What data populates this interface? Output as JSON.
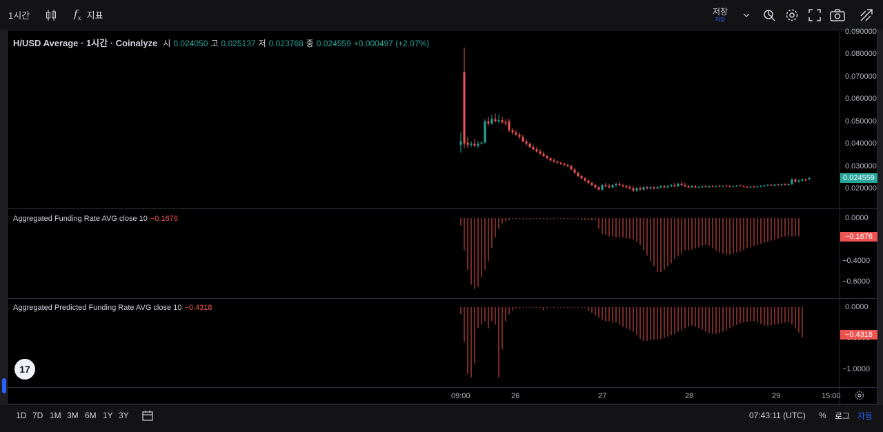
{
  "toolbar": {
    "interval": "1시간",
    "indicators_label": "지표",
    "save_label": "저장",
    "save_sub": "저장",
    "icons": [
      "candles-icon",
      "fx-icon",
      "chevron-down-icon",
      "replay-icon",
      "gear-icon",
      "fullscreen-icon",
      "camera-icon",
      "publish-icon"
    ]
  },
  "legend": {
    "title": "H/USD Average · 1시간 · Coinalyze",
    "open_label": "시",
    "open": "0.024050",
    "high_label": "고",
    "high": "0.025137",
    "low_label": "저",
    "low": "0.023768",
    "close_label": "종",
    "close": "0.024559",
    "change": "+0.000497 (+2.07%)"
  },
  "price_axis": {
    "ticks": [
      "0.090000",
      "0.080000",
      "0.070000",
      "0.060000",
      "0.050000",
      "0.040000",
      "0.030000",
      "0.020000"
    ],
    "last": "0.024559"
  },
  "funding": {
    "name": "Aggregated Funding Rate AVG close 10",
    "value": "−0.1676",
    "ticks": [
      "0.0000",
      "−0.2000",
      "−0.4000",
      "−0.6000"
    ],
    "tag": "−0.1676"
  },
  "predicted": {
    "name": "Aggregated Predicted Funding Rate AVG close 10",
    "value": "−0.4318",
    "ticks": [
      "0.0000",
      "−0.5000",
      "−1.0000"
    ],
    "tag": "−0.4318"
  },
  "time_axis": [
    "09:00",
    "26",
    "27",
    "28",
    "29",
    "15:00"
  ],
  "bottombar": {
    "ranges": [
      "1D",
      "7D",
      "1M",
      "3M",
      "6M",
      "1Y",
      "3Y"
    ],
    "clock": "07:43:11 (UTC)",
    "percent": "%",
    "log": "로그",
    "auto": "자동"
  },
  "colors": {
    "up": "#26a69a",
    "down": "#ef5350",
    "accent": "#2962ff"
  },
  "chart_data": {
    "type": "candlestick",
    "price_min": 0.015,
    "price_max": 0.09,
    "candles": [
      {
        "o": 0.0395,
        "h": 0.045,
        "l": 0.036,
        "c": 0.041
      },
      {
        "o": 0.072,
        "h": 0.083,
        "l": 0.038,
        "c": 0.04
      },
      {
        "o": 0.0405,
        "h": 0.043,
        "l": 0.038,
        "c": 0.0395
      },
      {
        "o": 0.0395,
        "h": 0.041,
        "l": 0.0385,
        "c": 0.04
      },
      {
        "o": 0.04,
        "h": 0.042,
        "l": 0.0385,
        "c": 0.039
      },
      {
        "o": 0.039,
        "h": 0.041,
        "l": 0.038,
        "c": 0.04
      },
      {
        "o": 0.04,
        "h": 0.041,
        "l": 0.0395,
        "c": 0.0405
      },
      {
        "o": 0.0405,
        "h": 0.051,
        "l": 0.04,
        "c": 0.05
      },
      {
        "o": 0.05,
        "h": 0.052,
        "l": 0.048,
        "c": 0.049
      },
      {
        "o": 0.049,
        "h": 0.053,
        "l": 0.0485,
        "c": 0.051
      },
      {
        "o": 0.051,
        "h": 0.0535,
        "l": 0.0495,
        "c": 0.05
      },
      {
        "o": 0.05,
        "h": 0.053,
        "l": 0.049,
        "c": 0.0505
      },
      {
        "o": 0.0505,
        "h": 0.052,
        "l": 0.049,
        "c": 0.0495
      },
      {
        "o": 0.0495,
        "h": 0.051,
        "l": 0.048,
        "c": 0.049
      },
      {
        "o": 0.05,
        "h": 0.051,
        "l": 0.045,
        "c": 0.046
      },
      {
        "o": 0.046,
        "h": 0.047,
        "l": 0.044,
        "c": 0.045
      },
      {
        "o": 0.045,
        "h": 0.046,
        "l": 0.0435,
        "c": 0.044
      },
      {
        "o": 0.044,
        "h": 0.045,
        "l": 0.042,
        "c": 0.043
      },
      {
        "o": 0.043,
        "h": 0.044,
        "l": 0.0405,
        "c": 0.041
      },
      {
        "o": 0.041,
        "h": 0.042,
        "l": 0.039,
        "c": 0.04
      },
      {
        "o": 0.04,
        "h": 0.0405,
        "l": 0.038,
        "c": 0.0385
      },
      {
        "o": 0.0385,
        "h": 0.0395,
        "l": 0.037,
        "c": 0.0375
      },
      {
        "o": 0.0375,
        "h": 0.0385,
        "l": 0.036,
        "c": 0.0365
      },
      {
        "o": 0.0365,
        "h": 0.0375,
        "l": 0.035,
        "c": 0.0355
      },
      {
        "o": 0.0355,
        "h": 0.0365,
        "l": 0.034,
        "c": 0.0345
      },
      {
        "o": 0.0345,
        "h": 0.035,
        "l": 0.033,
        "c": 0.0335
      },
      {
        "o": 0.0335,
        "h": 0.034,
        "l": 0.032,
        "c": 0.0325
      },
      {
        "o": 0.0325,
        "h": 0.0335,
        "l": 0.0315,
        "c": 0.032
      },
      {
        "o": 0.032,
        "h": 0.0325,
        "l": 0.031,
        "c": 0.0315
      },
      {
        "o": 0.0315,
        "h": 0.032,
        "l": 0.0305,
        "c": 0.031
      },
      {
        "o": 0.031,
        "h": 0.0315,
        "l": 0.03,
        "c": 0.0305
      },
      {
        "o": 0.0305,
        "h": 0.031,
        "l": 0.0295,
        "c": 0.03
      },
      {
        "o": 0.03,
        "h": 0.0305,
        "l": 0.028,
        "c": 0.0285
      },
      {
        "o": 0.0285,
        "h": 0.029,
        "l": 0.0265,
        "c": 0.027
      },
      {
        "o": 0.027,
        "h": 0.0275,
        "l": 0.025,
        "c": 0.0255
      },
      {
        "o": 0.0255,
        "h": 0.026,
        "l": 0.024,
        "c": 0.0245
      },
      {
        "o": 0.0245,
        "h": 0.025,
        "l": 0.023,
        "c": 0.0235
      },
      {
        "o": 0.0235,
        "h": 0.024,
        "l": 0.022,
        "c": 0.0225
      },
      {
        "o": 0.0225,
        "h": 0.023,
        "l": 0.021,
        "c": 0.0215
      },
      {
        "o": 0.0215,
        "h": 0.022,
        "l": 0.02,
        "c": 0.0205
      },
      {
        "o": 0.0205,
        "h": 0.021,
        "l": 0.019,
        "c": 0.0195
      },
      {
        "o": 0.0195,
        "h": 0.022,
        "l": 0.019,
        "c": 0.0215
      },
      {
        "o": 0.0215,
        "h": 0.0225,
        "l": 0.0205,
        "c": 0.021
      },
      {
        "o": 0.021,
        "h": 0.022,
        "l": 0.02,
        "c": 0.0205
      },
      {
        "o": 0.0205,
        "h": 0.022,
        "l": 0.02,
        "c": 0.0215
      },
      {
        "o": 0.0215,
        "h": 0.0225,
        "l": 0.0205,
        "c": 0.022
      },
      {
        "o": 0.022,
        "h": 0.023,
        "l": 0.021,
        "c": 0.0215
      },
      {
        "o": 0.0215,
        "h": 0.022,
        "l": 0.0205,
        "c": 0.021
      },
      {
        "o": 0.021,
        "h": 0.0215,
        "l": 0.02,
        "c": 0.0205
      },
      {
        "o": 0.0205,
        "h": 0.0215,
        "l": 0.0195,
        "c": 0.02
      },
      {
        "o": 0.02,
        "h": 0.021,
        "l": 0.0185,
        "c": 0.019
      },
      {
        "o": 0.019,
        "h": 0.0205,
        "l": 0.0185,
        "c": 0.02
      },
      {
        "o": 0.02,
        "h": 0.021,
        "l": 0.019,
        "c": 0.0195
      },
      {
        "o": 0.0195,
        "h": 0.021,
        "l": 0.019,
        "c": 0.0205
      },
      {
        "o": 0.0205,
        "h": 0.021,
        "l": 0.0195,
        "c": 0.02
      },
      {
        "o": 0.02,
        "h": 0.021,
        "l": 0.0195,
        "c": 0.0205
      },
      {
        "o": 0.0205,
        "h": 0.021,
        "l": 0.0195,
        "c": 0.02
      },
      {
        "o": 0.02,
        "h": 0.021,
        "l": 0.0195,
        "c": 0.0205
      },
      {
        "o": 0.0205,
        "h": 0.0215,
        "l": 0.02,
        "c": 0.021
      },
      {
        "o": 0.021,
        "h": 0.0215,
        "l": 0.02,
        "c": 0.0205
      },
      {
        "o": 0.0205,
        "h": 0.0215,
        "l": 0.02,
        "c": 0.021
      },
      {
        "o": 0.021,
        "h": 0.022,
        "l": 0.0205,
        "c": 0.0215
      },
      {
        "o": 0.0215,
        "h": 0.0225,
        "l": 0.0205,
        "c": 0.021
      },
      {
        "o": 0.021,
        "h": 0.0225,
        "l": 0.0205,
        "c": 0.022
      },
      {
        "o": 0.022,
        "h": 0.023,
        "l": 0.021,
        "c": 0.0215
      },
      {
        "o": 0.0215,
        "h": 0.0225,
        "l": 0.0205,
        "c": 0.021
      },
      {
        "o": 0.021,
        "h": 0.0215,
        "l": 0.02,
        "c": 0.0205
      },
      {
        "o": 0.0205,
        "h": 0.0215,
        "l": 0.02,
        "c": 0.021
      },
      {
        "o": 0.021,
        "h": 0.0215,
        "l": 0.02,
        "c": 0.0205
      },
      {
        "o": 0.0205,
        "h": 0.021,
        "l": 0.02,
        "c": 0.0207
      },
      {
        "o": 0.0207,
        "h": 0.0212,
        "l": 0.0202,
        "c": 0.0209
      },
      {
        "o": 0.0209,
        "h": 0.0214,
        "l": 0.0204,
        "c": 0.0206
      },
      {
        "o": 0.0206,
        "h": 0.0212,
        "l": 0.0202,
        "c": 0.021
      },
      {
        "o": 0.021,
        "h": 0.0215,
        "l": 0.0205,
        "c": 0.0208
      },
      {
        "o": 0.0208,
        "h": 0.0213,
        "l": 0.0203,
        "c": 0.0211
      },
      {
        "o": 0.0211,
        "h": 0.0216,
        "l": 0.0206,
        "c": 0.0209
      },
      {
        "o": 0.0209,
        "h": 0.0214,
        "l": 0.0204,
        "c": 0.0212
      },
      {
        "o": 0.0212,
        "h": 0.0217,
        "l": 0.0207,
        "c": 0.021
      },
      {
        "o": 0.021,
        "h": 0.0215,
        "l": 0.0205,
        "c": 0.0208
      },
      {
        "o": 0.0208,
        "h": 0.0212,
        "l": 0.0203,
        "c": 0.0211
      },
      {
        "o": 0.0211,
        "h": 0.0216,
        "l": 0.0206,
        "c": 0.0213
      },
      {
        "o": 0.0213,
        "h": 0.0217,
        "l": 0.0208,
        "c": 0.021
      },
      {
        "o": 0.021,
        "h": 0.0214,
        "l": 0.0205,
        "c": 0.0207
      },
      {
        "o": 0.0207,
        "h": 0.0212,
        "l": 0.0202,
        "c": 0.0205
      },
      {
        "o": 0.0205,
        "h": 0.021,
        "l": 0.02,
        "c": 0.0208
      },
      {
        "o": 0.0208,
        "h": 0.0213,
        "l": 0.0203,
        "c": 0.0206
      },
      {
        "o": 0.0206,
        "h": 0.0211,
        "l": 0.0201,
        "c": 0.0209
      },
      {
        "o": 0.0209,
        "h": 0.0215,
        "l": 0.0204,
        "c": 0.0212
      },
      {
        "o": 0.0212,
        "h": 0.0217,
        "l": 0.0207,
        "c": 0.0214
      },
      {
        "o": 0.0214,
        "h": 0.0219,
        "l": 0.0209,
        "c": 0.0216
      },
      {
        "o": 0.0216,
        "h": 0.0221,
        "l": 0.0211,
        "c": 0.0213
      },
      {
        "o": 0.0213,
        "h": 0.0219,
        "l": 0.0209,
        "c": 0.0217
      },
      {
        "o": 0.0217,
        "h": 0.0222,
        "l": 0.0212,
        "c": 0.0215
      },
      {
        "o": 0.0215,
        "h": 0.0221,
        "l": 0.0211,
        "c": 0.0218
      },
      {
        "o": 0.0218,
        "h": 0.0223,
        "l": 0.0213,
        "c": 0.0216
      },
      {
        "o": 0.0216,
        "h": 0.0222,
        "l": 0.0212,
        "c": 0.022
      },
      {
        "o": 0.022,
        "h": 0.0245,
        "l": 0.0215,
        "c": 0.024
      },
      {
        "o": 0.024,
        "h": 0.0245,
        "l": 0.0225,
        "c": 0.023
      },
      {
        "o": 0.023,
        "h": 0.024,
        "l": 0.0225,
        "c": 0.0235
      },
      {
        "o": 0.0235,
        "h": 0.0245,
        "l": 0.023,
        "c": 0.024
      },
      {
        "o": 0.024,
        "h": 0.0245,
        "l": 0.0232,
        "c": 0.0236
      },
      {
        "o": 0.024,
        "h": 0.0251,
        "l": 0.0238,
        "c": 0.0246
      }
    ],
    "funding": {
      "min": -0.68,
      "max": 0.0,
      "values": [
        -0.07,
        -0.3,
        -0.48,
        -0.62,
        -0.66,
        -0.64,
        -0.55,
        -0.48,
        -0.4,
        -0.28,
        -0.18,
        -0.1,
        -0.05,
        -0.03,
        -0.02,
        -0.01,
        -0.01,
        -0.01,
        -0.01,
        -0.01,
        -0.01,
        -0.01,
        -0.01,
        -0.01,
        -0.01,
        -0.01,
        -0.01,
        -0.01,
        -0.01,
        -0.01,
        -0.01,
        -0.01,
        -0.01,
        -0.01,
        -0.01,
        -0.02,
        -0.02,
        -0.02,
        -0.02,
        -0.02,
        -0.1,
        -0.15,
        -0.16,
        -0.17,
        -0.17,
        -0.18,
        -0.18,
        -0.18,
        -0.19,
        -0.19,
        -0.2,
        -0.22,
        -0.25,
        -0.3,
        -0.35,
        -0.4,
        -0.45,
        -0.5,
        -0.5,
        -0.48,
        -0.45,
        -0.42,
        -0.38,
        -0.35,
        -0.33,
        -0.3,
        -0.3,
        -0.29,
        -0.28,
        -0.27,
        -0.26,
        -0.25,
        -0.26,
        -0.28,
        -0.3,
        -0.32,
        -0.33,
        -0.34,
        -0.34,
        -0.33,
        -0.32,
        -0.31,
        -0.3,
        -0.28,
        -0.27,
        -0.26,
        -0.25,
        -0.24,
        -0.23,
        -0.22,
        -0.21,
        -0.2,
        -0.19,
        -0.18,
        -0.17,
        -0.17,
        -0.17,
        -0.17,
        -0.17
      ]
    },
    "predicted": {
      "min": -1.05,
      "max": 0.0,
      "values": [
        -0.1,
        -0.5,
        -0.95,
        -1.0,
        -0.8,
        -0.3,
        -0.25,
        -0.2,
        -0.3,
        -0.2,
        -0.25,
        -1.0,
        -0.6,
        -0.2,
        -0.1,
        -0.05,
        -0.02,
        -0.02,
        -0.01,
        -0.01,
        -0.01,
        -0.01,
        -0.01,
        -0.01,
        -0.05,
        -0.02,
        -0.01,
        -0.01,
        -0.01,
        -0.01,
        -0.01,
        -0.01,
        -0.01,
        -0.01,
        -0.01,
        -0.01,
        -0.01,
        -0.05,
        -0.08,
        -0.12,
        -0.15,
        -0.18,
        -0.2,
        -0.2,
        -0.22,
        -0.22,
        -0.25,
        -0.28,
        -0.3,
        -0.32,
        -0.35,
        -0.4,
        -0.45,
        -0.48,
        -0.48,
        -0.47,
        -0.46,
        -0.46,
        -0.45,
        -0.44,
        -0.42,
        -0.4,
        -0.38,
        -0.35,
        -0.33,
        -0.3,
        -0.28,
        -0.26,
        -0.28,
        -0.3,
        -0.32,
        -0.35,
        -0.37,
        -0.38,
        -0.38,
        -0.37,
        -0.35,
        -0.33,
        -0.3,
        -0.27,
        -0.25,
        -0.23,
        -0.22,
        -0.21,
        -0.2,
        -0.2,
        -0.22,
        -0.24,
        -0.26,
        -0.27,
        -0.26,
        -0.25,
        -0.24,
        -0.23,
        -0.22,
        -0.22,
        -0.25,
        -0.3,
        -0.36,
        -0.43
      ]
    }
  }
}
